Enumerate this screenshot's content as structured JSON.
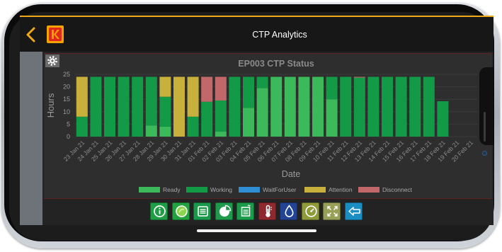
{
  "header": {
    "title": "CTP Analytics",
    "back_icon": "chevron-left-icon",
    "logo": "kodak-logo",
    "accent": "#f0a81b"
  },
  "chart_data": {
    "type": "bar",
    "stacked": true,
    "title": "EP003 CTP Status",
    "xlabel": "Date",
    "ylabel": "Hours",
    "ylim": [
      0,
      25
    ],
    "yticks": [
      0,
      5,
      10,
      15,
      20,
      25
    ],
    "grid": true,
    "legend": "bottom",
    "categories": [
      "23 Jan 21",
      "24 Jan 21",
      "25 Jan 21",
      "26 Jan 21",
      "27 Jan 21",
      "28 Jan 21",
      "29 Jan 21",
      "30 Jan 21",
      "31 Jan 21",
      "01 Feb 21",
      "02 Feb 21",
      "03 Feb 21",
      "04 Feb 21",
      "05 Feb 21",
      "06 Feb 21",
      "07 Feb 21",
      "08 Feb 21",
      "09 Feb 21",
      "10 Feb 21",
      "11 Feb 21",
      "12 Feb 21",
      "13 Feb 21",
      "14 Feb 21",
      "15 Feb 21",
      "16 Feb 21",
      "17 Feb 21",
      "18 Feb 21",
      "19 Feb 21",
      "20 Feb 21"
    ],
    "series": [
      {
        "name": "Ready",
        "color": "#3cb95a",
        "values": [
          0,
          0,
          0,
          0,
          0,
          4.5,
          4,
          0,
          0,
          0,
          2,
          0,
          11.5,
          19.5,
          24,
          24,
          24,
          24,
          15,
          0,
          0,
          0,
          0,
          0,
          0,
          0,
          0,
          0,
          0
        ]
      },
      {
        "name": "Working",
        "color": "#129a47",
        "values": [
          8,
          24,
          24,
          24,
          24,
          19.5,
          12,
          0,
          8,
          14,
          12.5,
          24,
          12.5,
          4.5,
          0,
          0,
          0,
          0,
          9,
          24,
          23.7,
          24,
          24,
          24,
          24,
          24,
          14.2,
          0,
          0
        ]
      },
      {
        "name": "WaitForUser",
        "color": "#2f8fd4",
        "values": [
          0,
          0,
          0,
          0,
          0,
          0,
          0,
          0,
          0,
          0,
          0,
          0,
          0,
          0,
          0,
          0,
          0,
          0,
          0,
          0,
          0,
          0,
          0,
          0,
          0,
          0,
          0,
          0,
          0
        ]
      },
      {
        "name": "Attention",
        "color": "#c8b03c",
        "values": [
          16,
          0,
          0,
          0,
          0,
          0,
          8,
          24,
          16,
          0,
          0,
          0,
          0,
          0,
          0,
          0,
          0,
          0,
          0,
          0,
          0,
          0,
          0,
          0,
          0,
          0,
          0,
          0,
          0
        ]
      },
      {
        "name": "Disconnect",
        "color": "#c2686b",
        "values": [
          0,
          0,
          0,
          0,
          0,
          0,
          0,
          0,
          0,
          10,
          9.5,
          0,
          0,
          0,
          0,
          0,
          0,
          0,
          0,
          0,
          0.3,
          0,
          0,
          0,
          0,
          0,
          0,
          0,
          0
        ]
      }
    ]
  },
  "settings": {
    "icon": "gear-icon"
  },
  "toolbar": {
    "buttons": [
      {
        "icon": "info-icon",
        "color": "#1f9e45"
      },
      {
        "icon": "status-circle-icon",
        "color": "#22a23f"
      },
      {
        "icon": "list-icon",
        "color": "#1a994a"
      },
      {
        "icon": "pie-chart-icon",
        "color": "#1d9a4a"
      },
      {
        "icon": "log-document-icon",
        "color": "#1b9a49"
      },
      {
        "icon": "thermometer-icon",
        "color": "#8e2a2f"
      },
      {
        "icon": "droplet-icon",
        "color": "#234495"
      },
      {
        "icon": "gauge-icon",
        "color": "#8f9b3b"
      },
      {
        "icon": "expand-arrows-icon",
        "color": "#98a058"
      },
      {
        "icon": "back-arrow-icon",
        "color": "#1a8dc2"
      }
    ]
  }
}
